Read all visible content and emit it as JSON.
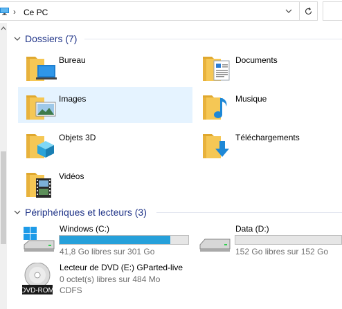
{
  "address": {
    "separator": "›",
    "location": "Ce PC"
  },
  "groups": {
    "folders": {
      "title": "Dossiers (7)",
      "items": [
        {
          "label": "Bureau",
          "icon": "desktop-folder-icon"
        },
        {
          "label": "Documents",
          "icon": "documents-folder-icon"
        },
        {
          "label": "Images",
          "icon": "pictures-folder-icon",
          "selected": true
        },
        {
          "label": "Musique",
          "icon": "music-folder-icon"
        },
        {
          "label": "Objets 3D",
          "icon": "3d-objects-folder-icon"
        },
        {
          "label": "Téléchargements",
          "icon": "downloads-folder-icon"
        },
        {
          "label": "Vidéos",
          "icon": "videos-folder-icon"
        }
      ]
    },
    "drives": {
      "title": "Périphériques et lecteurs (3)",
      "items": [
        {
          "name": "Windows (C:)",
          "info": "41,8 Go libres sur 301 Go",
          "used_fraction": 0.861,
          "icon": "windows-drive-icon"
        },
        {
          "name": "Data (D:)",
          "info": "152 Go libres sur 152 Go",
          "used_fraction": 0.0,
          "icon": "hard-drive-icon"
        },
        {
          "name": "Lecteur de DVD (E:) GParted-live",
          "info": "0 octet(s) libres sur 484 Mo",
          "info2": "CDFS",
          "disc_label": "DVD-ROM",
          "icon": "dvd-drive-icon"
        }
      ]
    }
  },
  "colors": {
    "accent": "#26a0da",
    "group_title": "#1e3287",
    "selection": "#e5f3ff",
    "folder": "#f5c755"
  }
}
